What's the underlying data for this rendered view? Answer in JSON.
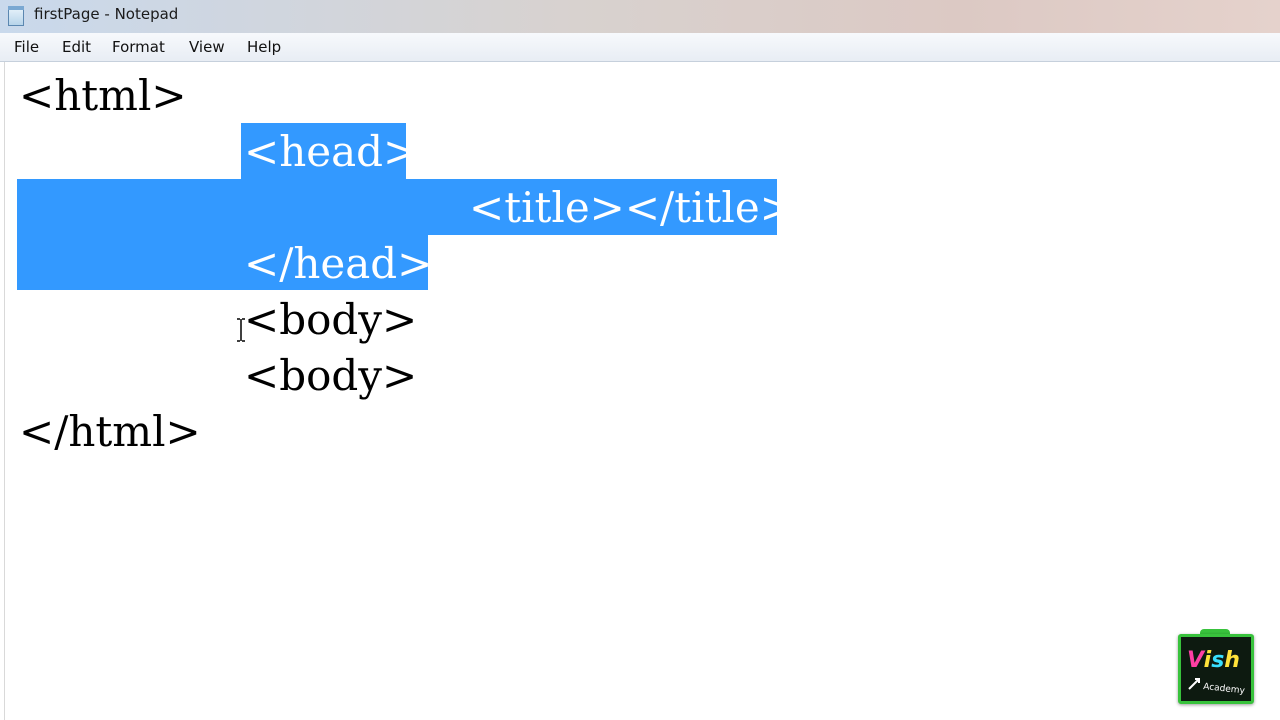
{
  "window": {
    "title": "firstPage - Notepad"
  },
  "menu": {
    "items": [
      "File",
      "Edit",
      "Format",
      "View",
      "Help"
    ]
  },
  "editor": {
    "lines": [
      "<html>",
      "<head>",
      "<title></title>",
      "</head>",
      "<body>",
      "<body>",
      "</html>"
    ],
    "selection_color": "#3399ff"
  },
  "watermark": {
    "logo_text": "Vish",
    "logo_subtext": "Academy"
  },
  "colors": {
    "logo_border": "#38c23c",
    "logo_bg": "#0d1a10"
  }
}
